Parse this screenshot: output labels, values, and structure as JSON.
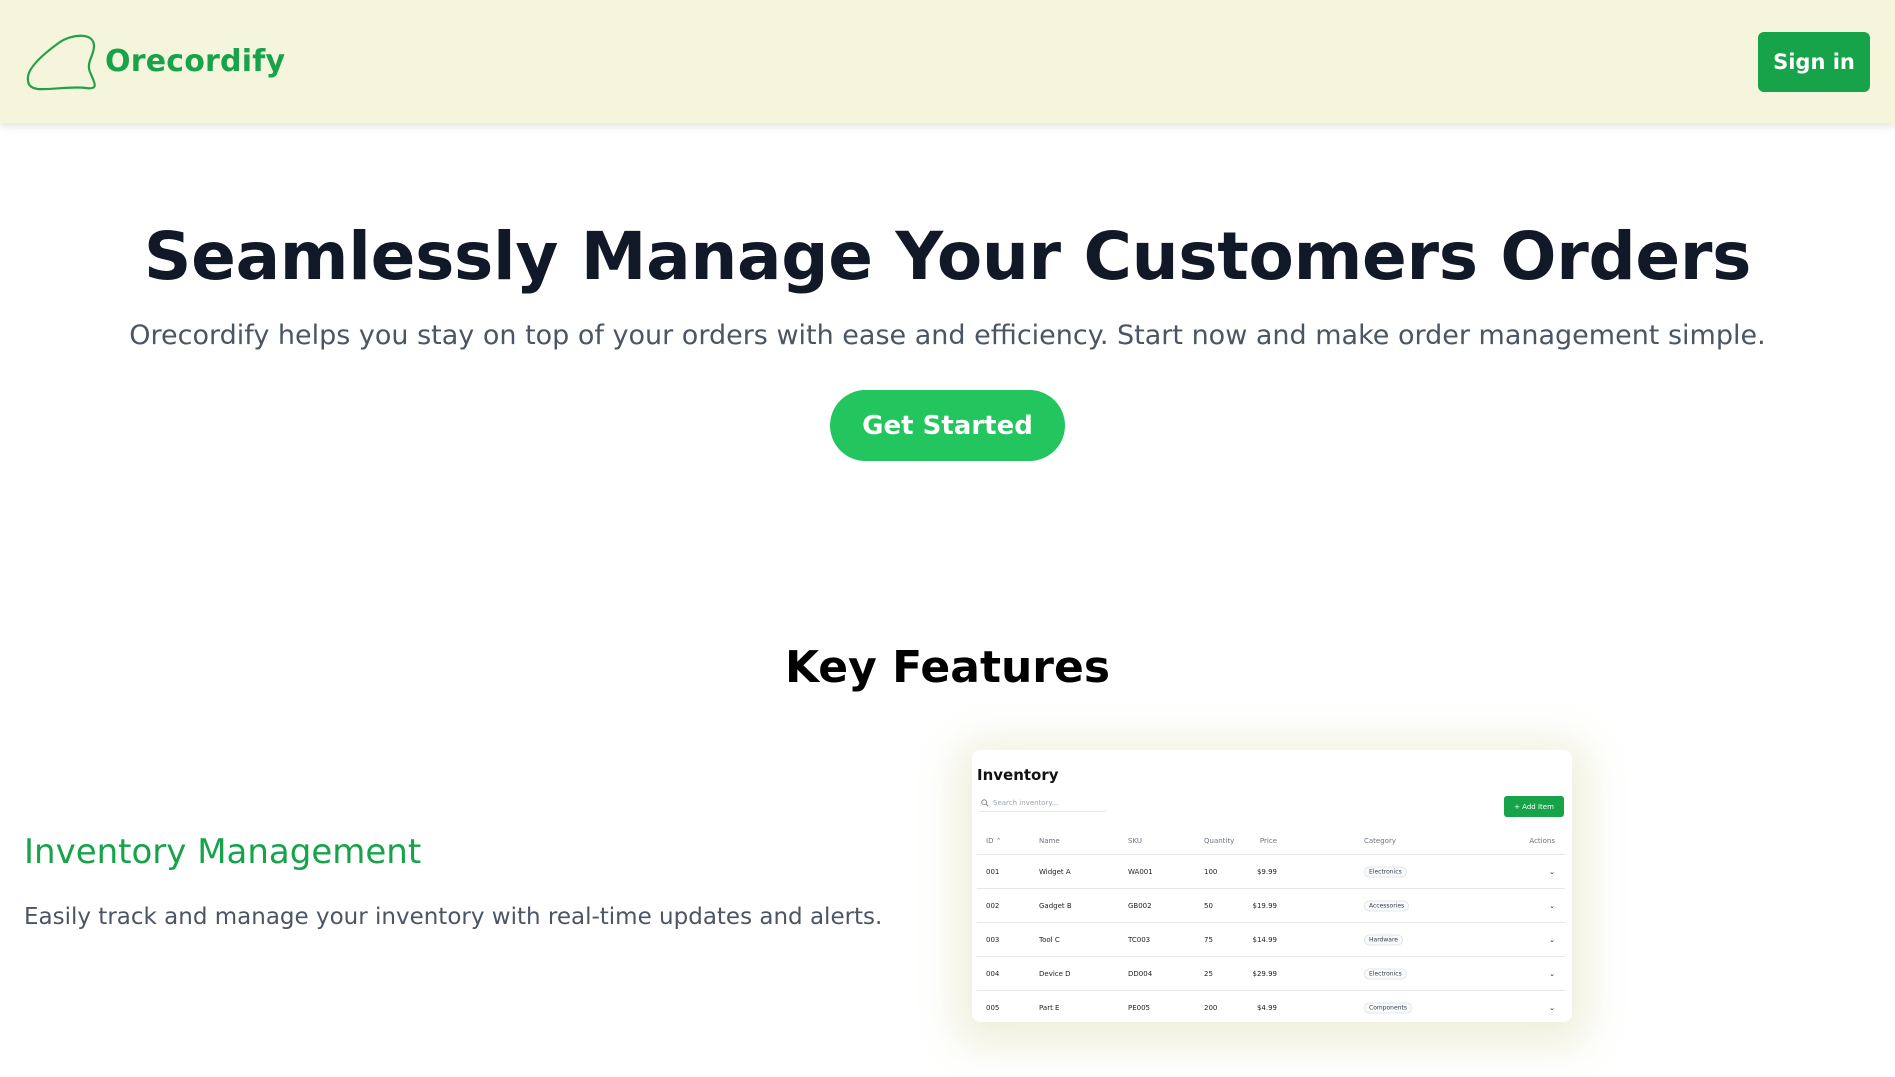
{
  "header": {
    "brand": "Orecordify",
    "signin_label": "Sign in",
    "logo_icon": "blob-logo-icon",
    "brand_color": "#16a34a",
    "background": "#f5f5dc"
  },
  "hero": {
    "title": "Seamlessly Manage Your Customers Orders",
    "subtitle": "Orecordify helps you stay on top of your orders with ease and efficiency. Start now and make order management simple.",
    "cta_label": "Get Started",
    "cta_color": "#22c55e"
  },
  "features": {
    "title": "Key Features",
    "items": [
      {
        "title": "Inventory Management",
        "description": "Easily track and manage your inventory with real-time updates and alerts."
      }
    ]
  },
  "inventory_preview": {
    "title": "Inventory",
    "search_placeholder": "Search inventory...",
    "add_label": "+ Add Item",
    "columns": [
      "ID",
      "Name",
      "SKU",
      "Quantity",
      "Price",
      "Category",
      "Actions"
    ],
    "rows": [
      {
        "id": "001",
        "name": "Widget A",
        "sku": "WA001",
        "qty": "100",
        "price": "$9.99",
        "category": "Electronics"
      },
      {
        "id": "002",
        "name": "Gadget B",
        "sku": "GB002",
        "qty": "50",
        "price": "$19.99",
        "category": "Accessories"
      },
      {
        "id": "003",
        "name": "Tool C",
        "sku": "TC003",
        "qty": "75",
        "price": "$14.99",
        "category": "Hardware"
      },
      {
        "id": "004",
        "name": "Device D",
        "sku": "DD004",
        "qty": "25",
        "price": "$29.99",
        "category": "Electronics"
      },
      {
        "id": "005",
        "name": "Part E",
        "sku": "PE005",
        "qty": "200",
        "price": "$4.99",
        "category": "Components"
      }
    ]
  }
}
